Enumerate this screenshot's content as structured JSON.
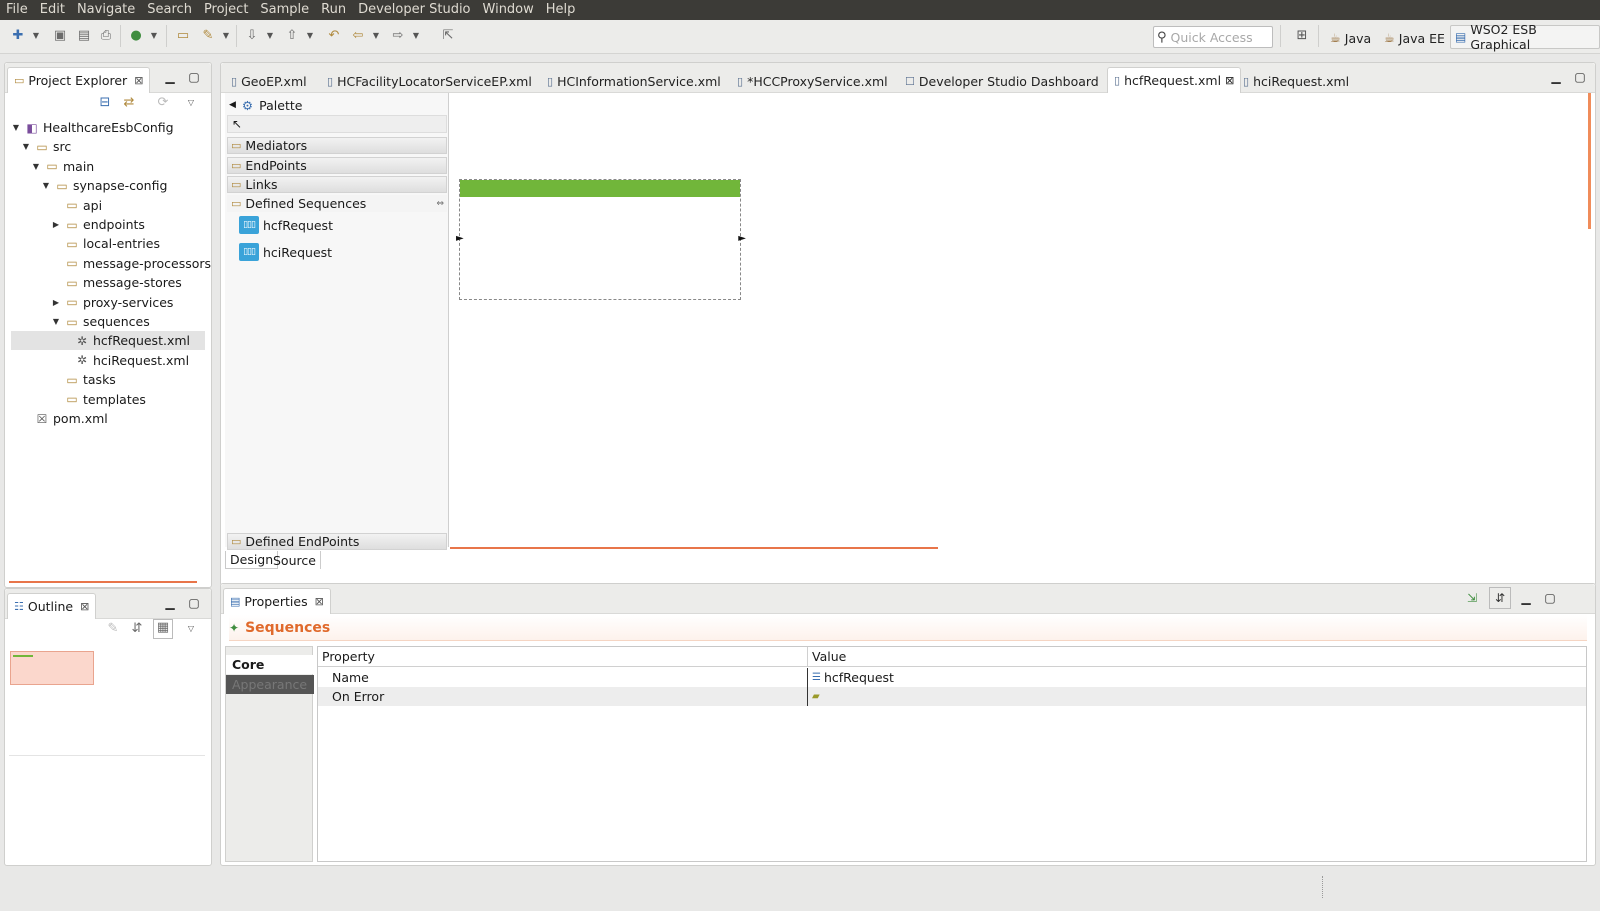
{
  "menubar": [
    "File",
    "Edit",
    "Navigate",
    "Search",
    "Project",
    "Sample",
    "Run",
    "Developer Studio",
    "Window",
    "Help"
  ],
  "toolbar": {
    "quick_access_placeholder": "Quick Access",
    "perspectives": [
      "Java",
      "Java EE",
      "WSO2 ESB Graphical"
    ]
  },
  "project_explorer": {
    "title": "Project Explorer",
    "tree": [
      {
        "label": "HealthcareEsbConfig",
        "depth": 0,
        "twisty": "open",
        "icon": "project-icon"
      },
      {
        "label": "src",
        "depth": 1,
        "twisty": "open",
        "icon": "folder-icon"
      },
      {
        "label": "main",
        "depth": 2,
        "twisty": "open",
        "icon": "folder-icon"
      },
      {
        "label": "synapse-config",
        "depth": 3,
        "twisty": "open",
        "icon": "folder-icon"
      },
      {
        "label": "api",
        "depth": 4,
        "twisty": "",
        "icon": "folder-icon"
      },
      {
        "label": "endpoints",
        "depth": 4,
        "twisty": "closed",
        "icon": "folder-icon"
      },
      {
        "label": "local-entries",
        "depth": 4,
        "twisty": "",
        "icon": "folder-icon"
      },
      {
        "label": "message-processors",
        "depth": 4,
        "twisty": "",
        "icon": "folder-icon"
      },
      {
        "label": "message-stores",
        "depth": 4,
        "twisty": "",
        "icon": "folder-icon"
      },
      {
        "label": "proxy-services",
        "depth": 4,
        "twisty": "closed",
        "icon": "folder-icon"
      },
      {
        "label": "sequences",
        "depth": 4,
        "twisty": "open",
        "icon": "folder-icon"
      },
      {
        "label": "hcfRequest.xml",
        "depth": 5,
        "twisty": "",
        "icon": "sequence-file-icon",
        "selected": true
      },
      {
        "label": "hciRequest.xml",
        "depth": 5,
        "twisty": "",
        "icon": "sequence-file-icon"
      },
      {
        "label": "tasks",
        "depth": 4,
        "twisty": "",
        "icon": "folder-icon"
      },
      {
        "label": "templates",
        "depth": 4,
        "twisty": "",
        "icon": "folder-icon"
      },
      {
        "label": "pom.xml",
        "depth": 1,
        "twisty": "",
        "icon": "xml-file-icon"
      }
    ]
  },
  "outline": {
    "title": "Outline"
  },
  "editor": {
    "tabs": [
      {
        "label": "GeoEP.xml",
        "active": false
      },
      {
        "label": "HCFacilityLocatorServiceEP.xml",
        "active": false
      },
      {
        "label": "HCInformationService.xml",
        "active": false
      },
      {
        "label": "*HCCProxyService.xml",
        "active": false
      },
      {
        "label": "Developer Studio Dashboard",
        "active": false
      },
      {
        "label": "hcfRequest.xml",
        "active": true
      },
      {
        "label": "hciRequest.xml",
        "active": false
      }
    ],
    "palette": {
      "title": "Palette",
      "drawers": [
        "Mediators",
        "EndPoints",
        "Links",
        "Defined Sequences"
      ],
      "sequences": [
        "hcfRequest",
        "hciRequest"
      ],
      "bottom_drawer": "Defined EndPoints"
    },
    "bottom_tabs": [
      "Design",
      "Source"
    ]
  },
  "properties": {
    "title": "Properties",
    "section_title": "Sequences",
    "tabs": [
      "Core",
      "Appearance"
    ],
    "columns": [
      "Property",
      "Value"
    ],
    "rows": [
      {
        "property": "Name",
        "value": "hcfRequest"
      },
      {
        "property": "On Error",
        "value": ""
      }
    ]
  },
  "colors": {
    "accent_orange": "#e06a2c",
    "sequence_bar_green": "#71b63a",
    "sequence_icon_blue": "#3aa3d9",
    "menubar_bg": "#3c3b37"
  }
}
